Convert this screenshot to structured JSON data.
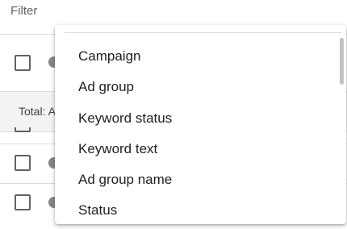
{
  "filter_bar": {
    "label": "Filter"
  },
  "table": {
    "total_label": "Total: A"
  },
  "dropdown": {
    "items": [
      {
        "label": "Campaign"
      },
      {
        "label": "Ad group"
      },
      {
        "label": "Keyword status"
      },
      {
        "label": "Keyword text"
      },
      {
        "label": "Ad group name"
      },
      {
        "label": "Status"
      }
    ]
  }
}
